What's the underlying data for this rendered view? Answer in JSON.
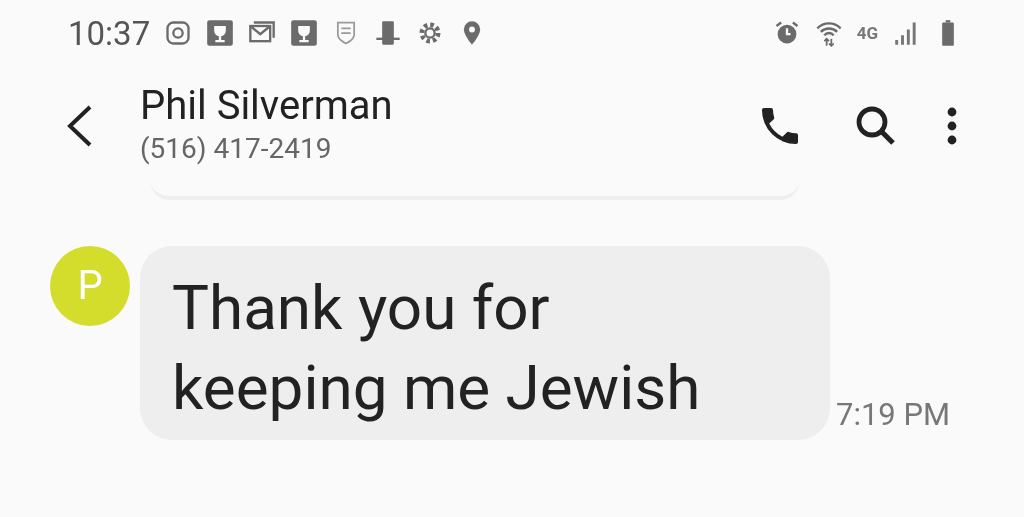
{
  "status_bar": {
    "time": "10:37",
    "network_type": "4G"
  },
  "header": {
    "contact_name": "Phil Silverman",
    "phone_number": "(516) 417-2419"
  },
  "messages": [
    {
      "avatar_letter": "P",
      "color": "#d4dc2c",
      "text": "Thank you for keeping me Jewish",
      "time": "7:19 PM"
    }
  ]
}
